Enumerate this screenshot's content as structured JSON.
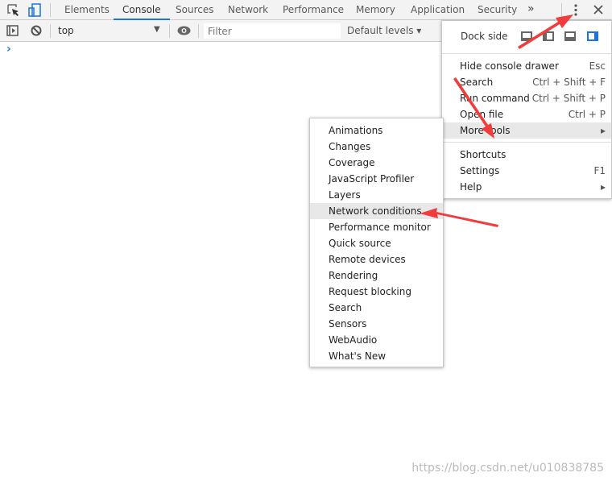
{
  "tabs": [
    "Elements",
    "Console",
    "Sources",
    "Network",
    "Performance",
    "Memory",
    "Application",
    "Security"
  ],
  "active_tab": "Console",
  "toolbar": {
    "context": "top",
    "filter_placeholder": "Filter",
    "levels": "Default levels ▾"
  },
  "prompt": "›",
  "main_menu": {
    "dock_side": "Dock side",
    "items": [
      {
        "label": "Hide console drawer",
        "shortcut": "Esc"
      },
      {
        "label": "Search",
        "shortcut": "Ctrl + Shift + F"
      },
      {
        "label": "Run command",
        "shortcut": "Ctrl + Shift + P"
      },
      {
        "label": "Open file",
        "shortcut": "Ctrl + P"
      },
      {
        "label": "More tools",
        "shortcut": "▸"
      }
    ],
    "items2": [
      {
        "label": "Shortcuts",
        "shortcut": ""
      },
      {
        "label": "Settings",
        "shortcut": "F1"
      },
      {
        "label": "Help",
        "shortcut": "▸"
      }
    ]
  },
  "more_tools": [
    "Animations",
    "Changes",
    "Coverage",
    "JavaScript Profiler",
    "Layers",
    "Network conditions",
    "Performance monitor",
    "Quick source",
    "Remote devices",
    "Rendering",
    "Request blocking",
    "Search",
    "Sensors",
    "WebAudio",
    "What's New"
  ],
  "highlighted_tool": "Network conditions",
  "watermark": "https://blog.csdn.net/u010838785",
  "colors": {
    "accent": "#1a73e8",
    "arrow": "#f03c3c"
  }
}
